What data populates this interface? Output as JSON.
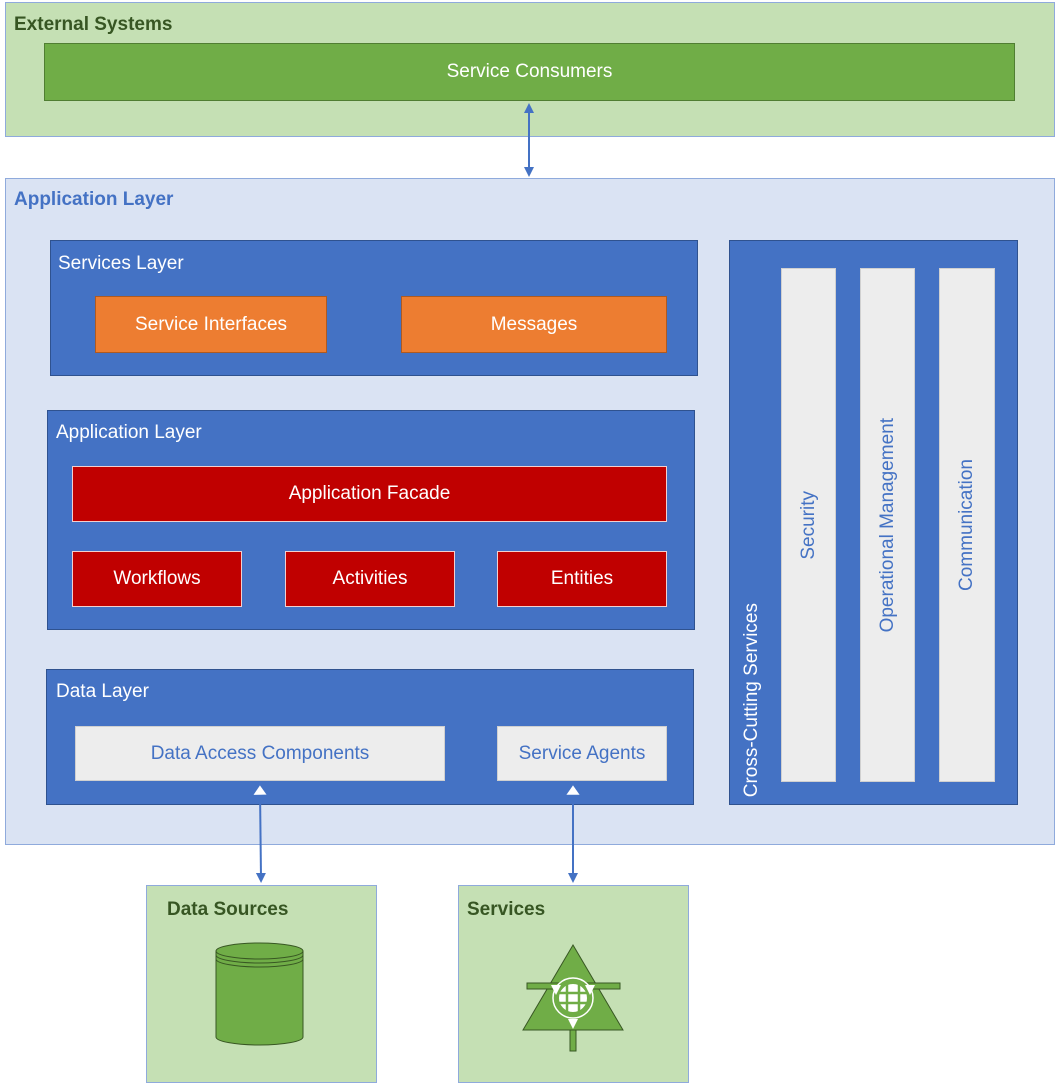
{
  "external": {
    "title": "External Systems",
    "consumers": "Service Consumers"
  },
  "app": {
    "title": "Application Layer",
    "services_layer": {
      "title": "Services Layer",
      "items": [
        "Service Interfaces",
        "Messages"
      ]
    },
    "application_layer": {
      "title": "Application Layer",
      "facade": "Application Facade",
      "items": [
        "Workflows",
        "Activities",
        "Entities"
      ]
    },
    "data_layer": {
      "title": "Data Layer",
      "items": [
        "Data Access Components",
        "Service Agents"
      ]
    },
    "cross_cutting": {
      "title": "Cross-Cutting Services",
      "items": [
        "Security",
        "Operational Management",
        "Communication"
      ]
    }
  },
  "bottom": {
    "data_sources": "Data Sources",
    "services": "Services"
  },
  "colors": {
    "green_bg": "#c5e0b4",
    "green": "#70ad47",
    "blue": "#4472c4",
    "light_blue": "#dae3f3",
    "orange": "#ed7d31",
    "red": "#c00000",
    "grey": "#ededed"
  },
  "icons": [
    "database-icon",
    "globe-service-icon"
  ]
}
